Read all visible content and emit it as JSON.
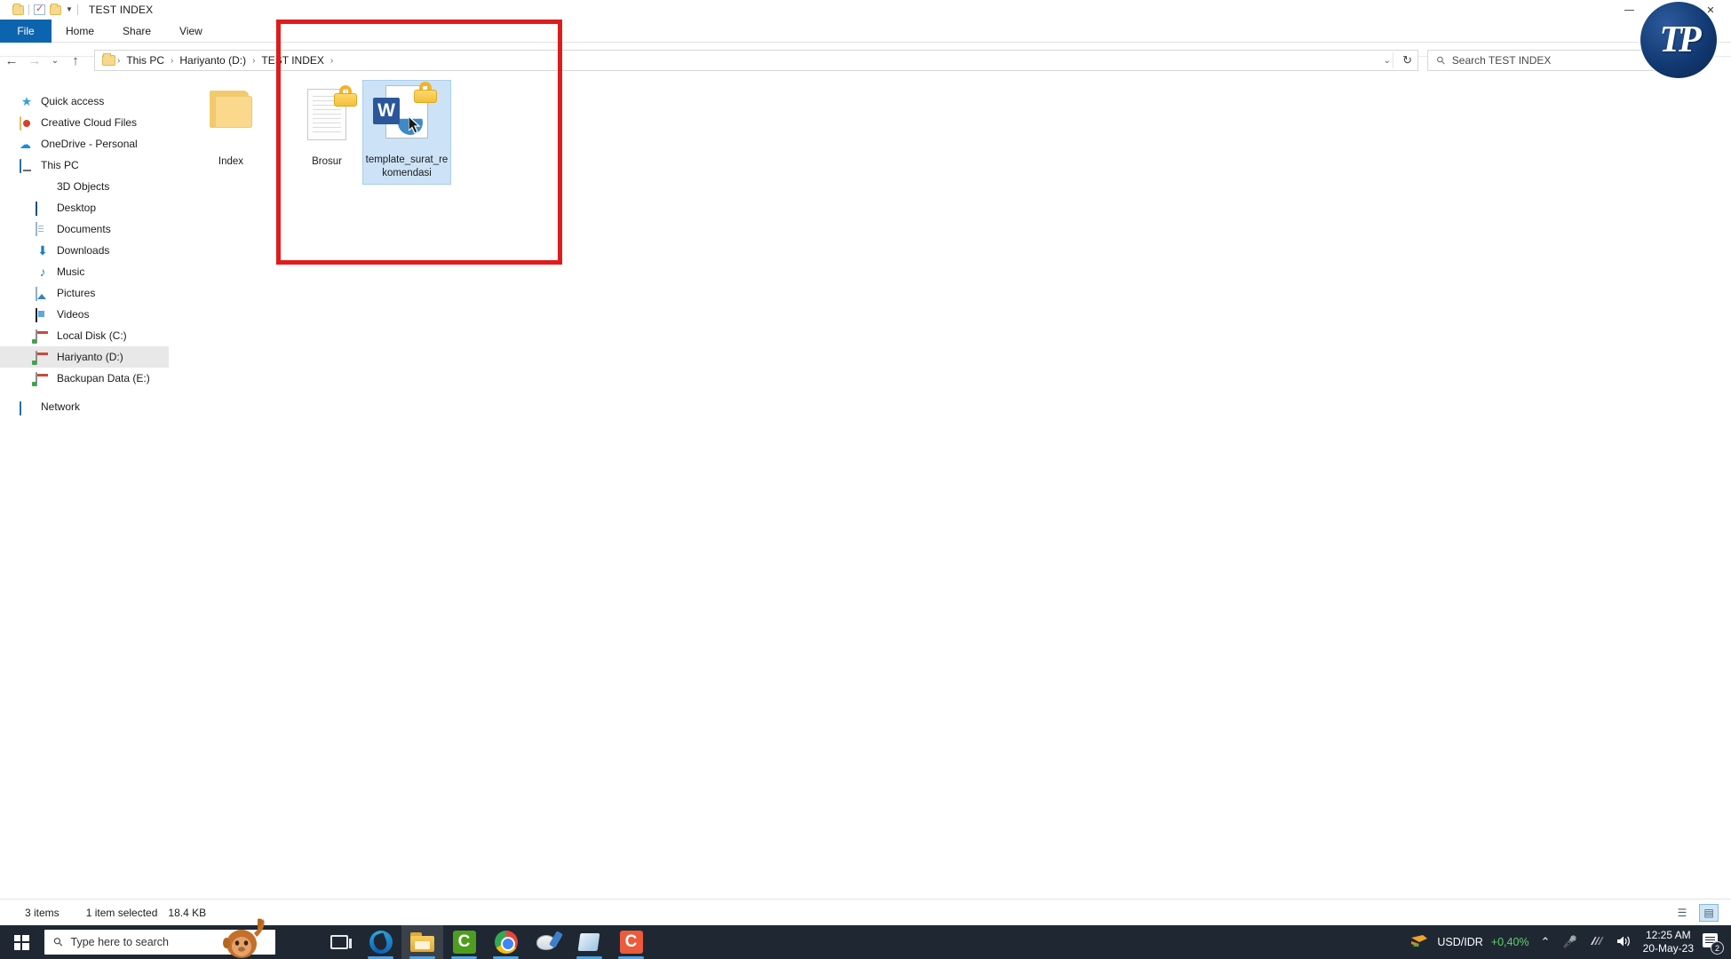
{
  "window": {
    "title": "TEST INDEX",
    "quick_access_icons": [
      "folder-icon",
      "properties-icon",
      "new-folder-icon",
      "customize-caret-icon"
    ],
    "controls": {
      "minimize": "minimize-icon",
      "maximize": "maximize-icon",
      "close": "close-icon"
    }
  },
  "ribbon": {
    "tabs": [
      {
        "label": "File"
      },
      {
        "label": "Home"
      },
      {
        "label": "Share"
      },
      {
        "label": "View"
      }
    ]
  },
  "addressbar": {
    "back_icon": "←",
    "forward_icon": "→",
    "recent_icon": "⌄",
    "up_icon": "↑",
    "breadcrumbs": [
      "This PC",
      "Hariyanto (D:)",
      "TEST INDEX"
    ],
    "dropdown_icon": "⌄",
    "refresh_icon": "↻",
    "search_placeholder": "Search TEST INDEX",
    "search_value": "",
    "search_icon": "search-icon"
  },
  "navpane": {
    "items": [
      {
        "label": "Quick access",
        "icon": "star-icon",
        "indent": false,
        "selected": false
      },
      {
        "label": "Creative Cloud Files",
        "icon": "creative-cloud-icon",
        "indent": false,
        "selected": false
      },
      {
        "label": "OneDrive - Personal",
        "icon": "onedrive-cloud-icon",
        "indent": false,
        "selected": false
      },
      {
        "label": "This PC",
        "icon": "this-pc-icon",
        "indent": false,
        "selected": false
      },
      {
        "label": "3D Objects",
        "icon": "3d-objects-icon",
        "indent": true,
        "selected": false
      },
      {
        "label": "Desktop",
        "icon": "desktop-icon",
        "indent": true,
        "selected": false
      },
      {
        "label": "Documents",
        "icon": "documents-icon",
        "indent": true,
        "selected": false
      },
      {
        "label": "Downloads",
        "icon": "downloads-icon",
        "indent": true,
        "selected": false
      },
      {
        "label": "Music",
        "icon": "music-icon",
        "indent": true,
        "selected": false
      },
      {
        "label": "Pictures",
        "icon": "pictures-icon",
        "indent": true,
        "selected": false
      },
      {
        "label": "Videos",
        "icon": "videos-icon",
        "indent": true,
        "selected": false
      },
      {
        "label": "Local Disk (C:)",
        "icon": "drive-icon",
        "indent": true,
        "selected": false
      },
      {
        "label": "Hariyanto (D:)",
        "icon": "drive-icon",
        "indent": true,
        "selected": true
      },
      {
        "label": "Backupan Data (E:)",
        "icon": "drive-icon",
        "indent": true,
        "selected": false
      },
      {
        "label": "Network",
        "icon": "network-icon",
        "indent": false,
        "selected": false
      }
    ]
  },
  "files": [
    {
      "name": "Index",
      "type": "folder",
      "selected": false,
      "locked": false
    },
    {
      "name": "Brosur",
      "type": "document",
      "selected": false,
      "locked": true
    },
    {
      "name": "template_surat_rekomendasi",
      "type": "word",
      "selected": true,
      "locked": true
    }
  ],
  "statusbar": {
    "item_count": "3 items",
    "selection": "1 item selected",
    "size": "18.4 KB",
    "view_details_icon": "details-view-icon",
    "view_thumbnails_icon": "thumbnail-view-icon"
  },
  "taskbar": {
    "start_icon": "windows-start-icon",
    "search_placeholder": "Type here to search",
    "taskview_icon": "task-view-icon",
    "apps": [
      {
        "name": "Microsoft Edge",
        "icon": "edge-icon",
        "running": true,
        "active": false
      },
      {
        "name": "File Explorer",
        "icon": "file-explorer-icon",
        "running": true,
        "active": true
      },
      {
        "name": "Camtasia Studio",
        "icon": "camtasia-icon",
        "running": true,
        "active": false
      },
      {
        "name": "Google Chrome",
        "icon": "chrome-icon",
        "running": true,
        "active": false
      },
      {
        "name": "Paint",
        "icon": "paint-icon",
        "running": false,
        "active": false
      },
      {
        "name": "Microsoft Store",
        "icon": "store-icon",
        "running": true,
        "active": false
      },
      {
        "name": "Camtasia Recorder",
        "icon": "camtasia-recorder-icon",
        "running": true,
        "active": false
      }
    ],
    "tray": {
      "ticker_label": "USD/IDR",
      "ticker_change": "+0,40%",
      "chevron_icon": "show-hidden-icons-icon",
      "mic_icon": "microphone-icon",
      "network_icon": "wifi-icon",
      "volume_icon": "volume-icon",
      "time": "12:25 AM",
      "date": "20-May-23",
      "notification_count": "2"
    }
  },
  "annotation": {
    "box_color": "#e01b1b"
  },
  "watermark": {
    "text": "TP"
  }
}
